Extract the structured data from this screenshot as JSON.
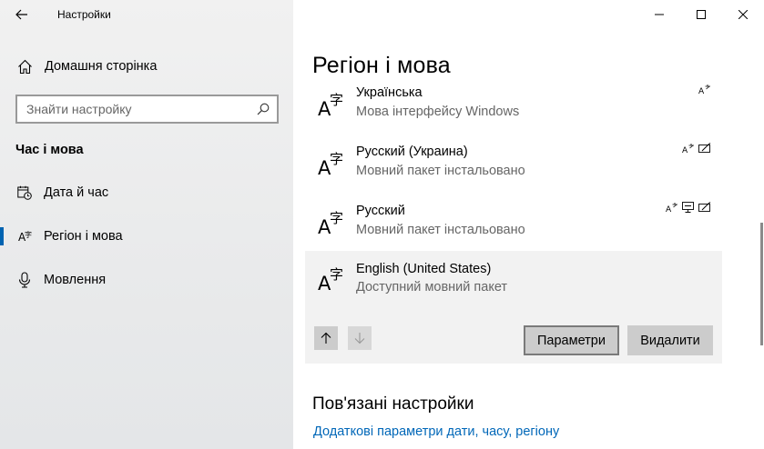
{
  "window": {
    "title": "Настройки"
  },
  "sidebar": {
    "home_label": "Домашня сторінка",
    "search_placeholder": "Знайти настройку",
    "section_title": "Час і мова",
    "items": [
      {
        "label": "Дата й час",
        "icon": "calendar-clock-icon",
        "active": false
      },
      {
        "label": "Регіон і мова",
        "icon": "globe-text-icon",
        "active": true
      },
      {
        "label": "Мовлення",
        "icon": "microphone-icon",
        "active": false
      }
    ]
  },
  "main": {
    "title": "Регіон і мова",
    "languages": [
      {
        "name": "Українська",
        "status": "Мова інтерфейсу Windows",
        "features": [
          "text-to-speech-icon"
        ]
      },
      {
        "name": "Русский (Украина)",
        "status": "Мовний пакет інстальовано",
        "features": [
          "text-to-speech-icon",
          "handwriting-icon"
        ]
      },
      {
        "name": "Русский",
        "status": "Мовний пакет інстальовано",
        "features": [
          "text-to-speech-icon",
          "display-language-icon",
          "handwriting-icon"
        ]
      },
      {
        "name": "English (United States)",
        "status": "Доступний мовний пакет",
        "features": []
      }
    ],
    "options_label": "Параметри",
    "remove_label": "Видалити",
    "related_title": "Пов'язані настройки",
    "related_link": "Додаткові параметри дати, часу, регіону"
  },
  "colors": {
    "accent": "#0063b1",
    "link": "#0067b8",
    "sidebar_bg": "#eaebec",
    "selected_bg": "#f2f2f2",
    "button_bg": "#cccccc"
  }
}
